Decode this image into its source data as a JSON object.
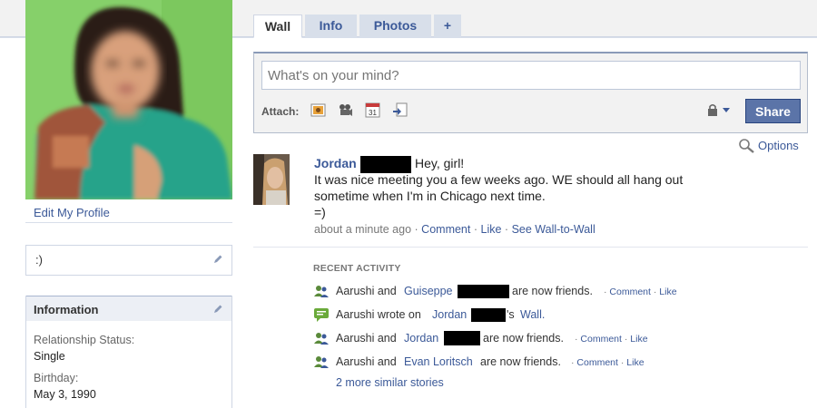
{
  "tabs": [
    {
      "label": "Wall",
      "active": true
    },
    {
      "label": "Info"
    },
    {
      "label": "Photos"
    },
    {
      "label": "+"
    }
  ],
  "sidebar": {
    "edit_profile": "Edit My Profile",
    "status": ":)",
    "information": {
      "title": "Information",
      "relationship_label": "Relationship Status:",
      "relationship_value": "Single",
      "birthday_label": "Birthday:",
      "birthday_value": "May 3, 1990"
    }
  },
  "composer": {
    "placeholder": "What's on your mind?",
    "attach_label": "Attach:",
    "attach_icons": [
      "photo-icon",
      "video-icon",
      "event-icon",
      "link-icon"
    ],
    "share_label": "Share"
  },
  "options_label": "Options",
  "post": {
    "author": "Jordan",
    "greeting": "Hey, girl!",
    "lines": [
      "It was nice meeting you a few weeks ago. WE should all hang out",
      "sometime when I'm in Chicago next time.",
      "=)"
    ],
    "time": "about a minute ago",
    "sep": "·",
    "comment": "Comment",
    "like": "Like",
    "wall_to_wall": "See Wall-to-Wall"
  },
  "recent_activity": {
    "title": "RECENT ACTIVITY",
    "items": [
      {
        "pre": "Aarushi and",
        "link": "Guiseppe",
        "post": "are now friends.",
        "comment": "Comment",
        "like": "Like"
      },
      {
        "pre": "Aarushi wrote on",
        "link": "Jordan",
        "post": "'s",
        "link2": "Wall."
      },
      {
        "pre": "Aarushi and",
        "link": "Jordan",
        "post": "are now friends.",
        "comment": "Comment",
        "like": "Like"
      },
      {
        "pre": "Aarushi and",
        "link": "Evan Loritsch",
        "post": "are now friends.",
        "comment": "Comment",
        "like": "Like"
      }
    ],
    "more": "2 more similar stories"
  },
  "colors": {
    "link": "#3b5998",
    "share_bg": "#5b74a8",
    "tab_bg": "#d8dfea"
  }
}
